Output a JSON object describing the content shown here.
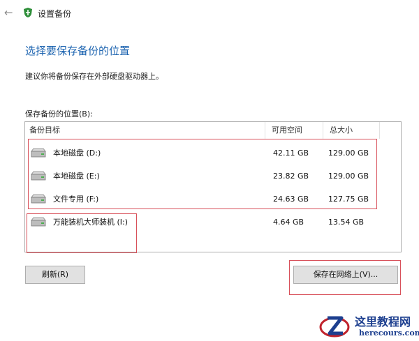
{
  "window": {
    "title": "设置备份",
    "back_glyph": "←",
    "icon": "backup-shield-icon"
  },
  "page": {
    "heading": "选择要保存备份的位置",
    "description": "建议你将备份保存在外部硬盘驱动器上。",
    "list_label": "保存备份的位置(B):"
  },
  "table": {
    "columns": [
      "备份目标",
      "可用空间",
      "总大小"
    ],
    "rows": [
      {
        "name": "本地磁盘 (D:)",
        "free": "42.11 GB",
        "total": "129.00 GB",
        "icon": "hard-drive-icon"
      },
      {
        "name": "本地磁盘 (E:)",
        "free": "23.82 GB",
        "total": "129.00 GB",
        "icon": "hard-drive-icon"
      },
      {
        "name": "文件专用 (F:)",
        "free": "24.63 GB",
        "total": "127.75 GB",
        "icon": "hard-drive-icon"
      },
      {
        "name": "万能装机大师装机 (I:)",
        "free": "4.64 GB",
        "total": "13.54 GB",
        "icon": "hard-drive-icon"
      }
    ]
  },
  "buttons": {
    "refresh": "刷新(R)",
    "save_network": "保存在网络上(V)..."
  },
  "watermark": {
    "title": "这里教程网",
    "url": "herecours.com"
  },
  "colors": {
    "heading": "#1d64b0",
    "highlight": "#d8505a",
    "button_bg": "#e1e1e1",
    "watermark": "#1d3f8f"
  }
}
